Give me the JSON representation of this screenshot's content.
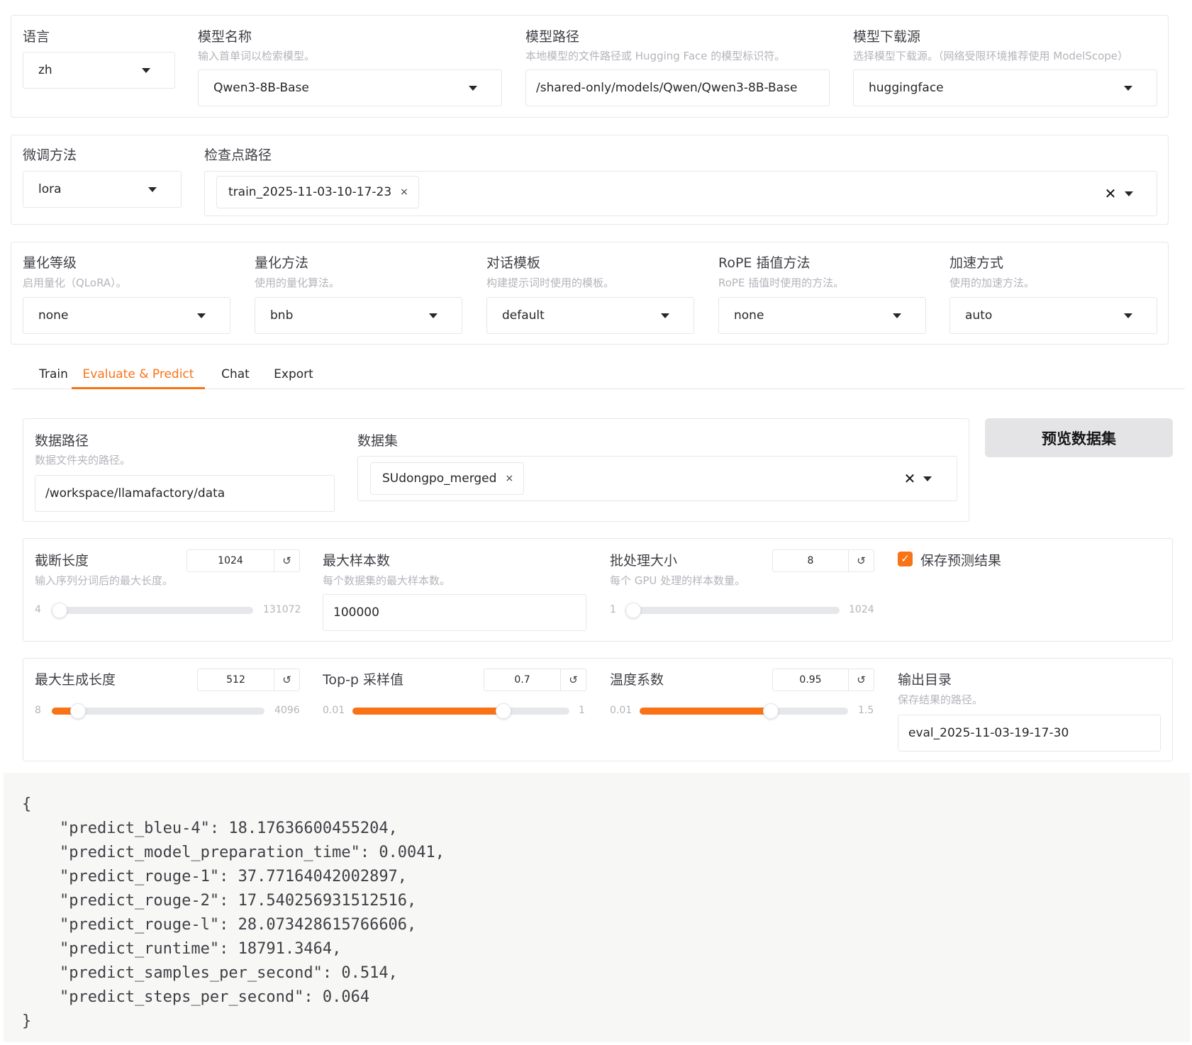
{
  "top": {
    "language": {
      "label": "语言",
      "value": "zh"
    },
    "model_name": {
      "label": "模型名称",
      "info": "输入首单词以检索模型。",
      "value": "Qwen3-8B-Base"
    },
    "model_path": {
      "label": "模型路径",
      "info": "本地模型的文件路径或 Hugging Face 的模型标识符。",
      "value": "/shared-only/models/Qwen/Qwen3-8B-Base"
    },
    "hub": {
      "label": "模型下载源",
      "info": "选择模型下载源。（网络受限环境推荐使用 ModelScope）",
      "value": "huggingface"
    }
  },
  "finetune": {
    "method": {
      "label": "微调方法",
      "value": "lora"
    },
    "checkpoint": {
      "label": "检查点路径",
      "chips": [
        "train_2025-11-03-10-17-23"
      ]
    }
  },
  "advanced": {
    "quant_bit": {
      "label": "量化等级",
      "info": "启用量化（QLoRA）。",
      "value": "none"
    },
    "quant_method": {
      "label": "量化方法",
      "info": "使用的量化算法。",
      "value": "bnb"
    },
    "template": {
      "label": "对话模板",
      "info": "构建提示词时使用的模板。",
      "value": "default"
    },
    "rope": {
      "label": "RoPE 插值方法",
      "info": "RoPE 插值时使用的方法。",
      "value": "none"
    },
    "booster": {
      "label": "加速方式",
      "info": "使用的加速方法。",
      "value": "auto"
    }
  },
  "tabs": [
    "Train",
    "Evaluate & Predict",
    "Chat",
    "Export"
  ],
  "active_tab": "Evaluate & Predict",
  "eval": {
    "dataset_dir": {
      "label": "数据路径",
      "info": "数据文件夹的路径。",
      "value": "/workspace/llamafactory/data"
    },
    "dataset": {
      "label": "数据集",
      "chips": [
        "SUdongpo_merged"
      ]
    },
    "preview_button": "预览数据集",
    "cutoff_len": {
      "label": "截断长度",
      "info": "输入序列分词后的最大长度。",
      "value": 1024,
      "min": 4,
      "max": 131072
    },
    "max_samples": {
      "label": "最大样本数",
      "info": "每个数据集的最大样本数。",
      "value": "100000"
    },
    "batch_size": {
      "label": "批处理大小",
      "info": "每个 GPU 处理的样本数量。",
      "value": 8,
      "min": 1,
      "max": 1024
    },
    "predict": {
      "label": "保存预测结果",
      "checked": true
    },
    "max_new_tokens": {
      "label": "最大生成长度",
      "value": 512,
      "min": 8,
      "max": 4096
    },
    "top_p": {
      "label": "Top-p 采样值",
      "value": 0.7,
      "min": 0.01,
      "max": 1
    },
    "temperature": {
      "label": "温度系数",
      "value": 0.95,
      "min": 0.01,
      "max": 1.5
    },
    "output_dir": {
      "label": "输出目录",
      "info": "保存结果的路径。",
      "value": "eval_2025-11-03-19-17-30"
    }
  },
  "output_json": [
    "{",
    "    \"predict_bleu-4\": 18.17636600455204,",
    "    \"predict_model_preparation_time\": 0.0041,",
    "    \"predict_rouge-1\": 37.77164042002897,",
    "    \"predict_rouge-2\": 17.540256931512516,",
    "    \"predict_rouge-l\": 28.073428615766606,",
    "    \"predict_runtime\": 18791.3464,",
    "    \"predict_samples_per_second\": 0.514,",
    "    \"predict_steps_per_second\": 0.064",
    "}"
  ],
  "icons": {
    "reset": "↺",
    "clear": "✕",
    "chip_remove": "×",
    "check": "✓"
  },
  "colors": {
    "accent": "#f97316",
    "border": "#e5e7eb",
    "button_bg": "#e4e4e7"
  }
}
